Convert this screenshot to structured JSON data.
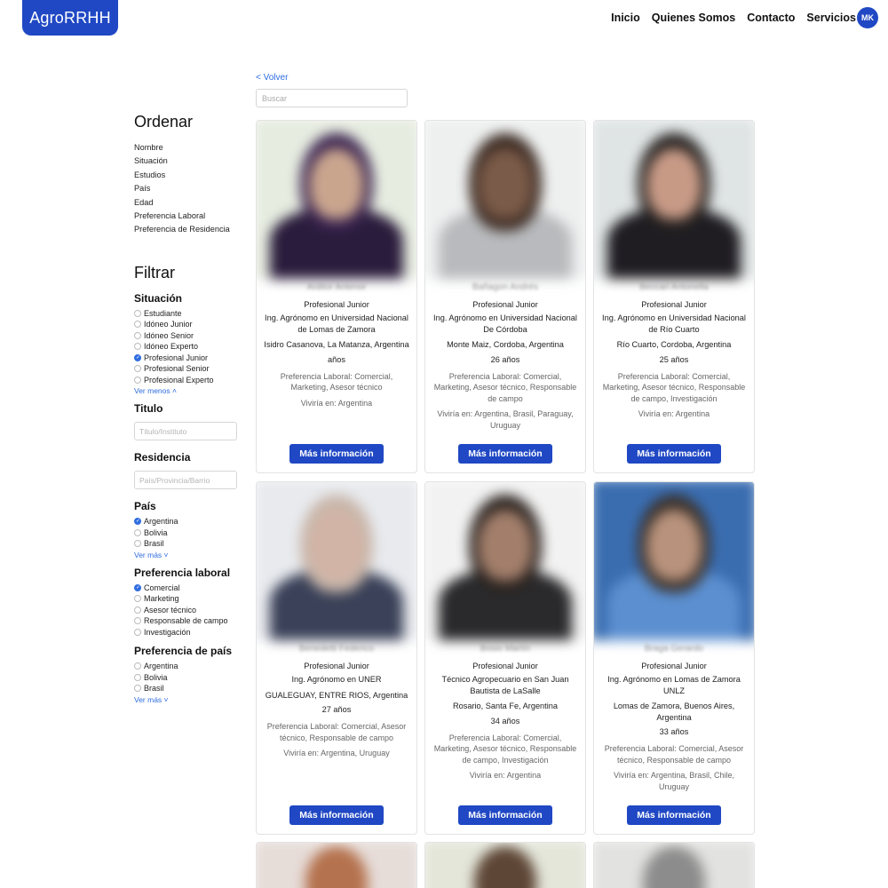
{
  "header": {
    "logo": "AgroRRHH",
    "nav": [
      "Inicio",
      "Quienes Somos",
      "Contacto",
      "Servicios"
    ],
    "avatar_initials": "MK"
  },
  "back_link": "< Volver",
  "search": {
    "placeholder": "Buscar"
  },
  "sidebar": {
    "sort_title": "Ordenar",
    "sort_options": [
      "Nombre",
      "Situación",
      "Estudios",
      "País",
      "Edad",
      "Preferencia Laboral",
      "Preferencia de Residencia"
    ],
    "filter_title": "Filtrar",
    "situacion": {
      "title": "Situación",
      "options": [
        "Estudiante",
        "Idóneo Junior",
        "Idóneo Senior",
        "Idóneo Experto",
        "Profesional Junior",
        "Profesional Senior",
        "Profesional Experto"
      ],
      "selected": "Profesional Junior",
      "toggle": "Ver menos ˄"
    },
    "titulo": {
      "title": "Titulo",
      "placeholder": "Título/Instituto"
    },
    "residencia": {
      "title": "Residencia",
      "placeholder": "País/Provincia/Barrio"
    },
    "pais": {
      "title": "País",
      "options": [
        "Argentina",
        "Bolivia",
        "Brasil"
      ],
      "selected": "Argentina",
      "toggle": "Ver más ˅"
    },
    "preferencia_laboral": {
      "title": "Preferencia laboral",
      "options": [
        "Comercial",
        "Marketing",
        "Asesor técnico",
        "Responsable de campo",
        "Investigación"
      ],
      "selected": "Comercial"
    },
    "preferencia_pais": {
      "title": "Preferencia de país",
      "options": [
        "Argentina",
        "Bolivia",
        "Brasil"
      ],
      "toggle": "Ver más ˅"
    }
  },
  "button_label": "Más información",
  "cards": [
    {
      "name": "Arditor Antenor",
      "role": "Profesional Junior",
      "study": "Ing. Agrónomo en Universidad Nacional de Lomas de Zamora",
      "location": "Isidro Casanova, La Matanza, Argentina",
      "age": "años",
      "pref": "Preferencia Laboral: Comercial, Marketing, Asesor técnico",
      "viviria": "Viviría en: Argentina",
      "colors": {
        "bg": "#e6ece0",
        "face": "#c9a58e",
        "body": "#2a1c3c",
        "hair": "#3a2350"
      }
    },
    {
      "name": "Bañagon Andrés",
      "role": "Profesional Junior",
      "study": "Ing. Agrónomo en Universidad Nacional De Córdoba",
      "location": "Monte Maiz, Cordoba, Argentina",
      "age": "26 años",
      "pref": "Preferencia Laboral: Comercial, Marketing, Asesor técnico, Responsable de campo",
      "viviria": "Viviría en: Argentina, Brasil, Paraguay, Uruguay",
      "colors": {
        "bg": "#eef0f0",
        "face": "#7a5a48",
        "body": "#b8babd",
        "hair": "#3b2a22"
      }
    },
    {
      "name": "Beccari Antonella",
      "role": "Profesional Junior",
      "study": "Ing. Agrónomo en Universidad Nacional de Río Cuarto",
      "location": "Río Cuarto, Cordoba, Argentina",
      "age": "25 años",
      "pref": "Preferencia Laboral: Comercial, Marketing, Asesor técnico, Responsable de campo, Investigación",
      "viviria": "Viviría en: Argentina",
      "colors": {
        "bg": "#dfe4e4",
        "face": "#c79a86",
        "body": "#1f1d22",
        "hair": "#24201f"
      }
    },
    {
      "name": "Benedetti Federico",
      "role": "Profesional Junior",
      "study": "Ing. Agrónomo en UNER",
      "location": "GUALEGUAY, ENTRE RIOS, Argentina",
      "age": "27 años",
      "pref": "Preferencia Laboral: Comercial, Asesor técnico, Responsable de campo",
      "viviria": "Viviría en: Argentina, Uruguay",
      "colors": {
        "bg": "#e8eaee",
        "face": "#d2b4a6",
        "body": "#3a4158",
        "hair": "#c8b6aa"
      }
    },
    {
      "name": "Bosio Martín",
      "role": "Profesional Junior",
      "study": "Técnico Agropecuario en San Juan Bautista de LaSalle",
      "location": "Rosario, Santa Fe, Argentina",
      "age": "34 años",
      "pref": "Preferencia Laboral: Comercial, Marketing, Asesor técnico, Responsable de campo, Investigación",
      "viviria": "Viviría en: Argentina",
      "colors": {
        "bg": "#f2f2f2",
        "face": "#a27e6b",
        "body": "#2a2a2c",
        "hair": "#2b231f"
      }
    },
    {
      "name": "Braga Gerardo",
      "role": "Profesional Junior",
      "study": "Ing. Agrónomo en Lomas de Zamora UNLZ",
      "location": "Lomas de Zamora, Buenos Aires, Argentina",
      "age": "33 años",
      "pref": "Preferencia Laboral: Comercial, Asesor técnico, Responsable de campo",
      "viviria": "Viviría en: Argentina, Brasil, Chile, Uruguay",
      "colors": {
        "bg": "#3a6db0",
        "face": "#b8927c",
        "body": "#5b8fd0",
        "hair": "#3a3029"
      }
    }
  ],
  "partial_cards": [
    {
      "colors": {
        "bg": "#e6dcd8",
        "face": "#b5724e"
      }
    },
    {
      "colors": {
        "bg": "#e4e6da",
        "face": "#5e4636"
      }
    },
    {
      "colors": {
        "bg": "#e2e2e0",
        "face": "#8c8c8c"
      }
    }
  ]
}
